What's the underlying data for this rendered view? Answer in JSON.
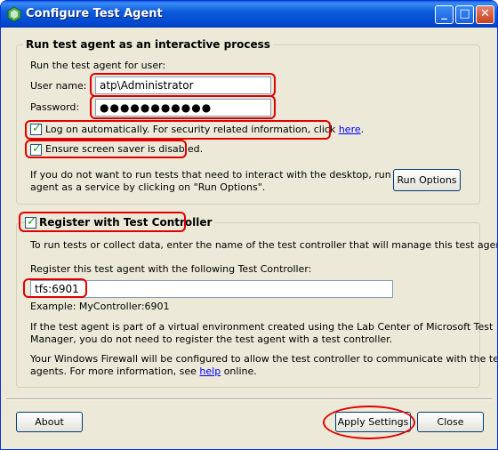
{
  "window": {
    "title": "Configure Test Agent"
  },
  "interactive_group": {
    "legend": "Run test agent as an interactive process",
    "run_for_user": "Run the test agent for user:",
    "username_label": "User name:",
    "username_value": "atp\\Administrator",
    "password_label": "Password:",
    "password_value": "●●●●●●●●●●●",
    "logon_auto_text": "Log on automatically. For security related information, click ",
    "logon_auto_link": "here",
    "logon_auto_tail": ".",
    "screensaver_text": "Ensure screen saver is disabled.",
    "service_info_line1": "If you do not want to run tests that need to interact with the desktop, run the test",
    "service_info_line2": "agent as a service by clicking on \"Run Options\".",
    "run_options_button": "Run Options"
  },
  "controller_group": {
    "legend": "Register with Test Controller",
    "intro": "To run tests or collect data, enter the name of the test controller that will manage this test agent.",
    "register_label": "Register this test agent with the following Test Controller:",
    "controller_value": "tfs:6901",
    "example": "Example: MyController:6901",
    "virtual_line1": "If the test agent is part of a virtual environment created using the Lab Center of Microsoft Test",
    "virtual_line2": "Manager, you do not need to register the test agent with a test controller.",
    "firewall_line1": "Your Windows Firewall will be configured to allow the test controller to communicate with the test",
    "firewall_line2_pre": "agents. For more information, see ",
    "firewall_link": "help",
    "firewall_line2_post": " online."
  },
  "footer": {
    "about_button": "About",
    "apply_button": "Apply Settings",
    "close_button": "Close"
  },
  "colors": {
    "highlight": "#e00000",
    "titlebar": "#0046cf",
    "link": "#0000ff"
  }
}
